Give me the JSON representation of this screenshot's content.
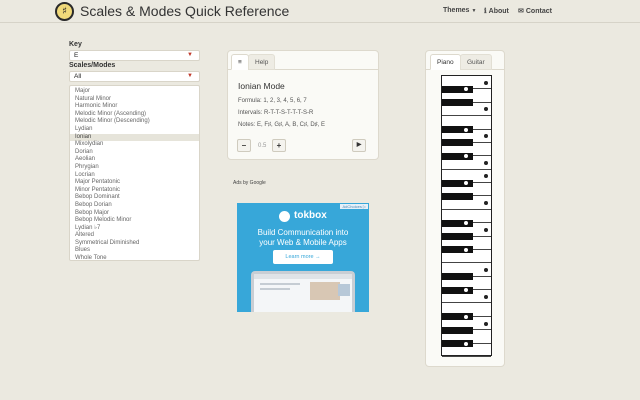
{
  "navbar": {
    "logo_glyph": "♯",
    "title": "Scales & Modes Quick Reference",
    "themes_label": "Themes",
    "about_icon": "info-icon",
    "about_label": "About",
    "contact_icon": "envelope-icon",
    "contact_label": "Contact"
  },
  "sidebar": {
    "key_label": "Key",
    "key_value": "E",
    "scales_label": "Scales/Modes",
    "scales_filter": "All",
    "items": [
      "Major",
      "Natural Minor",
      "Harmonic Minor",
      "Melodic Minor (Ascending)",
      "Melodic Minor (Descending)",
      "Lydian",
      "Ionian",
      "Mixolydian",
      "Dorian",
      "Aeolian",
      "Phrygian",
      "Locrian",
      "Major Pentatonic",
      "Minor Pentatonic",
      "Bebop Dominant",
      "Bebop Dorian",
      "Bebop Major",
      "Bebop Melodic Minor",
      "Lydian ♭7",
      "Altered",
      "Symmetrical Diminished",
      "Blues",
      "Whole Tone"
    ],
    "selected_index": 6
  },
  "info_card": {
    "tabs": [
      "≡",
      "Help"
    ],
    "title": "Ionian Mode",
    "formula": "Formula: 1, 2, 3, 4, 5, 6, 7",
    "intervals": "Intervals: R-T-T-S-T-T-T-S-R",
    "notes": "Notes: E, F♯, G♯, A, B, C♯, D♯, E",
    "minus_label": "–",
    "speed": "0.5",
    "plus_label": "+",
    "play_label": "▶"
  },
  "ad": {
    "ads_by": "Ads by Google",
    "choices": "AdChoices ▷",
    "brand": "tokbox",
    "headline_1": "Build Communication into",
    "headline_2": "your Web & Mobile Apps",
    "cta": "Learn more →"
  },
  "instrument_card": {
    "tabs": [
      "Piano",
      "Guitar"
    ],
    "accent_color": "#222222"
  }
}
